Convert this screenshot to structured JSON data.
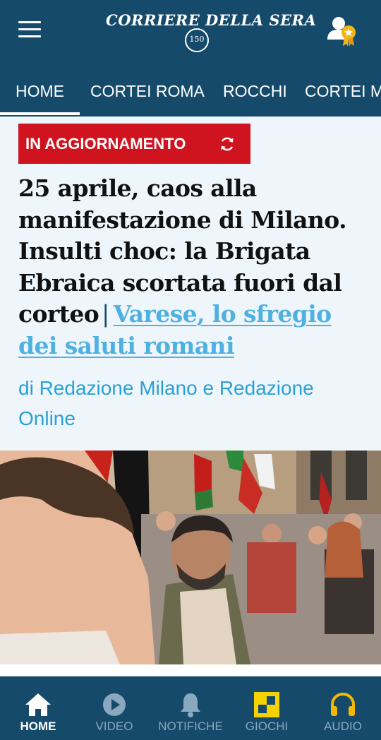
{
  "header": {
    "logo_text": "CORRIERE DELLA SERA",
    "logo_seal": "150",
    "menu_icon": "hamburger-menu-icon",
    "profile_icon": "user-premium-icon"
  },
  "tabs": [
    {
      "label": "HOME"
    },
    {
      "label": "CORTEI ROMA"
    },
    {
      "label": "ROCCHI"
    },
    {
      "label": "CORTEI M"
    }
  ],
  "article": {
    "badge": "IN AGGIORNAMENTO",
    "headline": "25 aprile, caos alla manifestazione di Milano. Insulti choc: la Brigata Ebraica scortata fuori dal corteo",
    "separator": "|",
    "related_link": "Varese, lo sfregio dei saluti romani",
    "byline": "di Redazione Milano e Redazione Online"
  },
  "bottom_nav": [
    {
      "label": "HOME",
      "icon": "home-icon"
    },
    {
      "label": "VIDEO",
      "icon": "play-icon"
    },
    {
      "label": "NOTIFICHE",
      "icon": "bell-icon"
    },
    {
      "label": "GIOCHI",
      "icon": "puzzle-grid-icon"
    },
    {
      "label": "AUDIO",
      "icon": "headphones-icon"
    }
  ],
  "colors": {
    "brand_blue": "#154a6b",
    "badge_red": "#d0141f",
    "link_blue": "#4fb0e2",
    "games_yellow": "#f5d200"
  }
}
